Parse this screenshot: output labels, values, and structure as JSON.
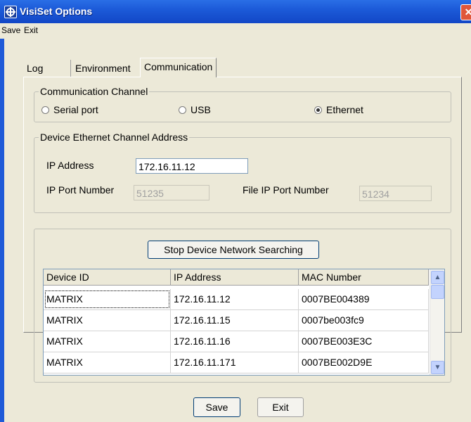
{
  "window": {
    "title": "VisiSet Options",
    "close_glyph": "✕"
  },
  "menu": {
    "items": [
      "Save",
      "Exit"
    ]
  },
  "tabs": [
    {
      "label": "Log"
    },
    {
      "label": "Environment"
    },
    {
      "label": "Communication"
    }
  ],
  "comm_channel": {
    "title": "Communication Channel",
    "options": [
      {
        "label": "Serial port",
        "selected": false
      },
      {
        "label": "USB",
        "selected": false
      },
      {
        "label": "Ethernet",
        "selected": true
      }
    ]
  },
  "ethernet": {
    "title": "Device Ethernet Channel Address",
    "ip_label": "IP Address",
    "ip_value": "172.16.11.12",
    "port_label": "IP Port Number",
    "port_value": "51235",
    "file_port_label": "File IP Port Number",
    "file_port_value": "51234"
  },
  "search_button": "Stop Device Network Searching",
  "devices": {
    "columns": [
      "Device ID",
      "IP Address",
      "MAC Number"
    ],
    "rows": [
      [
        "MATRIX",
        "172.16.11.12",
        "0007BE004389"
      ],
      [
        "MATRIX",
        "172.16.11.15",
        "0007be003fc9"
      ],
      [
        "MATRIX",
        "172.16.11.16",
        "0007BE003E3C"
      ],
      [
        "MATRIX",
        "172.16.11.171",
        "0007BE002D9E"
      ]
    ]
  },
  "footer": {
    "save": "Save",
    "exit": "Exit"
  },
  "colors": {
    "titlebar": "#1c5ad8",
    "face": "#ece9d8",
    "close": "#e0573a"
  }
}
